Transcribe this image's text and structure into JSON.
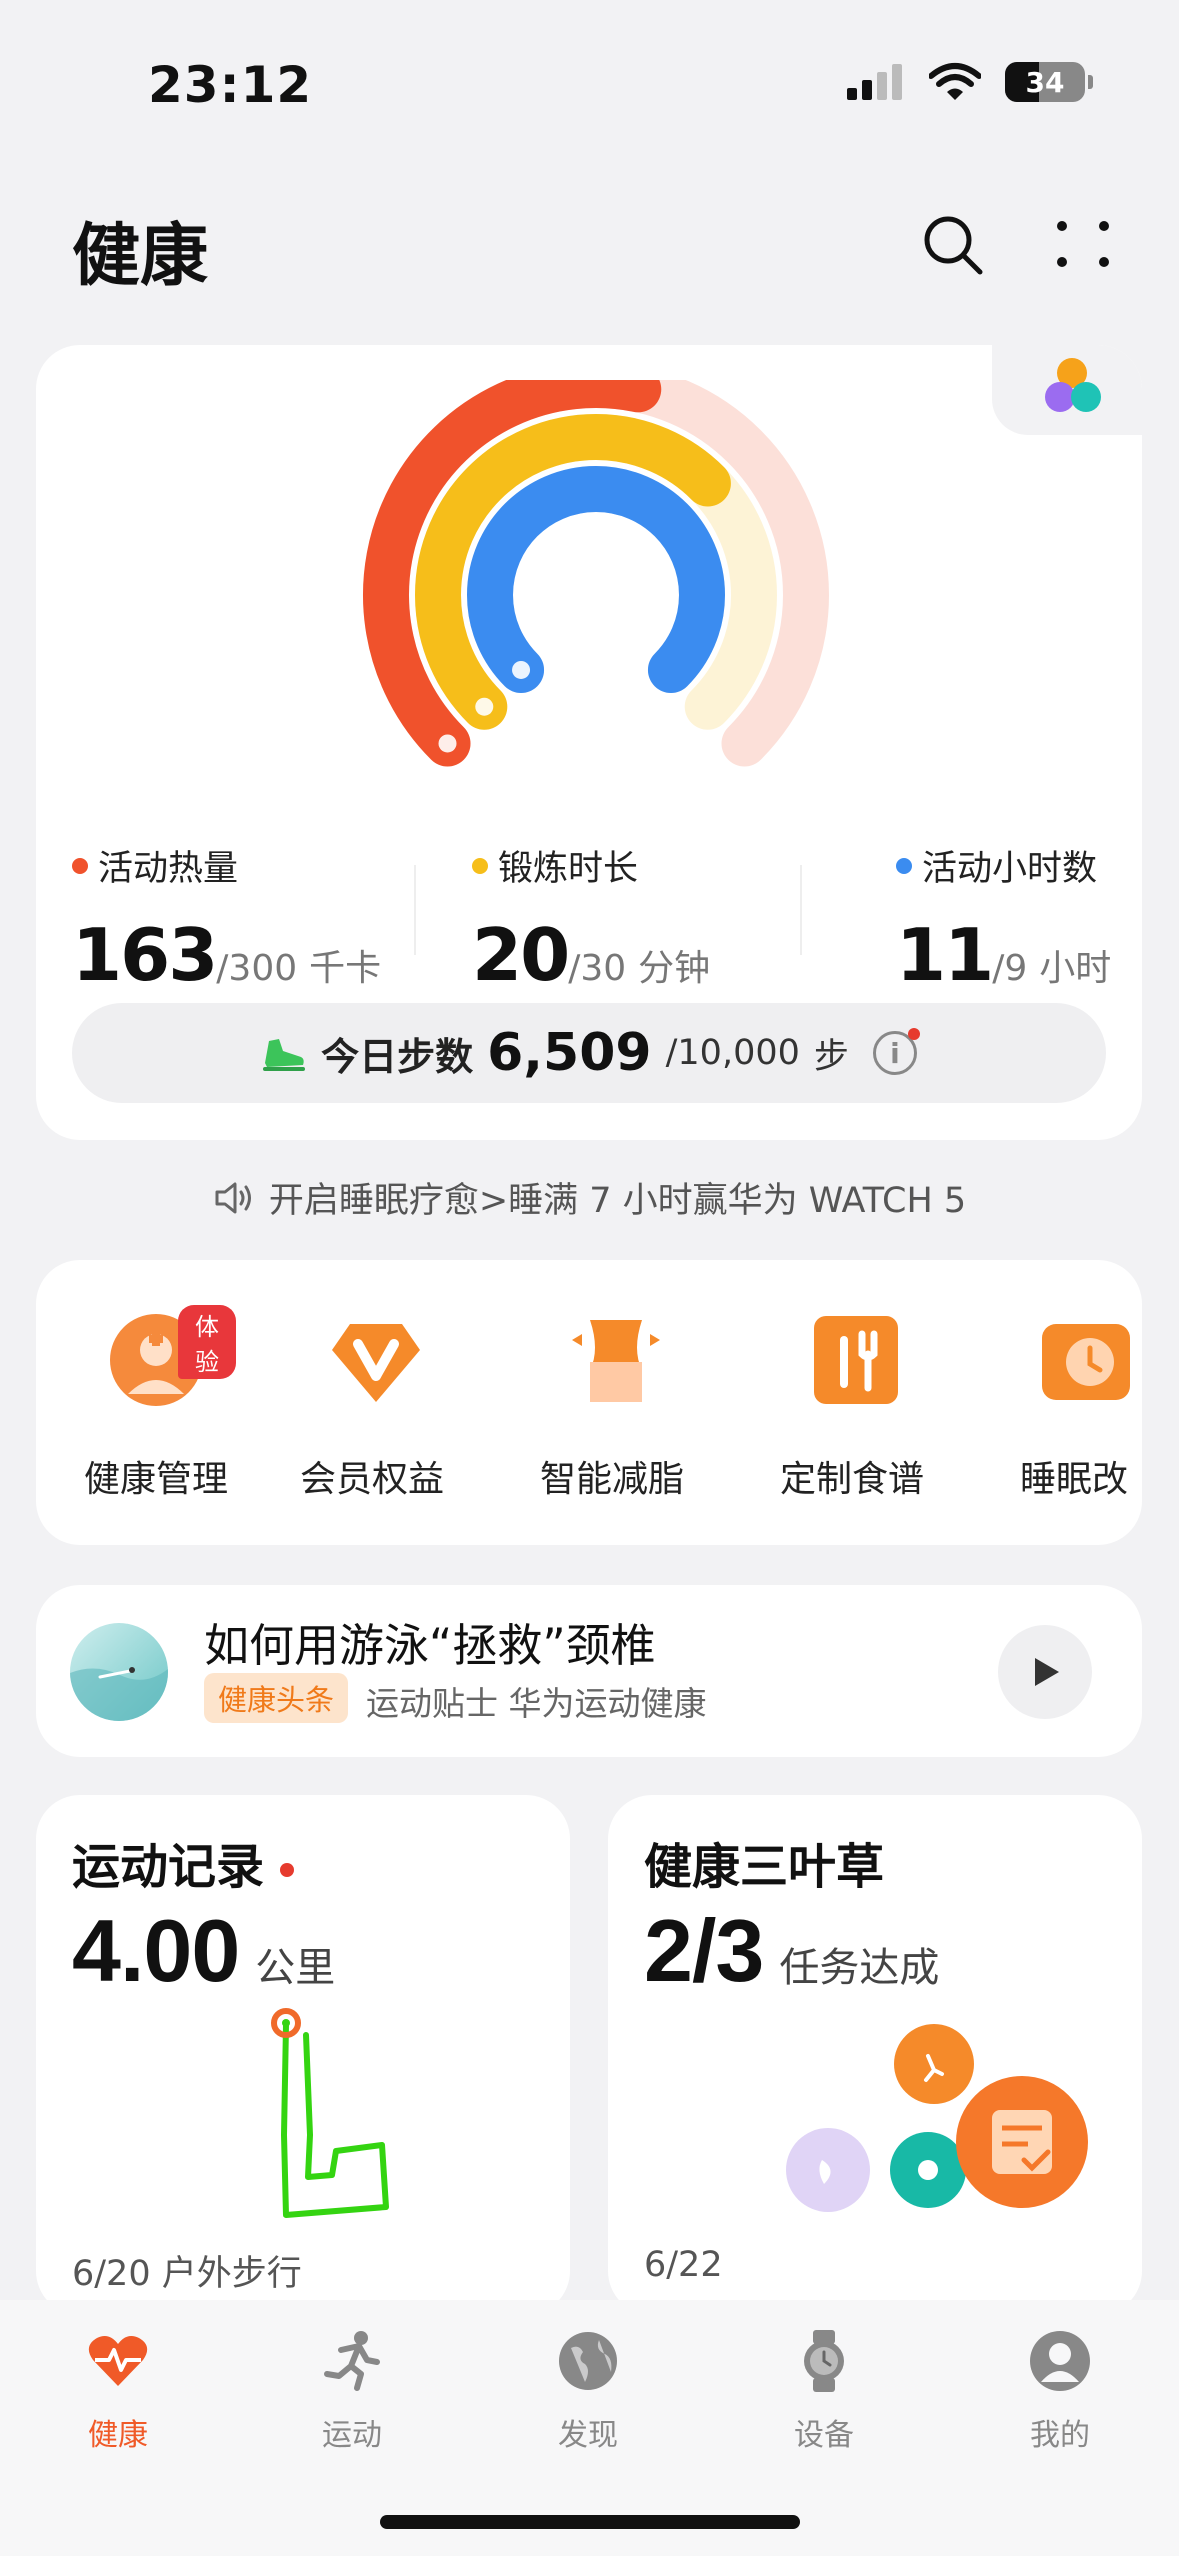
{
  "status_bar": {
    "time": "23:12",
    "battery": "34"
  },
  "header": {
    "title": "健康"
  },
  "activity": {
    "metrics": [
      {
        "label": "活动热量",
        "value": "163",
        "target": "/300",
        "unit": "千卡",
        "color": "#f0522c"
      },
      {
        "label": "锻炼时长",
        "value": "20",
        "target": "/30",
        "unit": "分钟",
        "color": "#f6be1a"
      },
      {
        "label": "活动小时数",
        "value": "11",
        "target": "/9",
        "unit": "小时",
        "color": "#3b8cf0"
      }
    ],
    "rings": [
      {
        "name": "活动热量",
        "progress": 0.543,
        "color": "#f0522c"
      },
      {
        "name": "锻炼时长",
        "progress": 0.667,
        "color": "#f6be1a"
      },
      {
        "name": "活动小时数",
        "progress": 1.0,
        "color": "#3b8cf0"
      }
    ],
    "steps": {
      "label": "今日步数",
      "value": "6,509",
      "target": "/10,000",
      "unit": "步"
    }
  },
  "notice": {
    "text": "开启睡眠疗愈>睡满 7 小时赢华为 WATCH 5"
  },
  "shortcuts": [
    {
      "label": "健康管理",
      "icon": "doctor-icon",
      "badge": "体验"
    },
    {
      "label": "会员权益",
      "icon": "vip-icon"
    },
    {
      "label": "智能减脂",
      "icon": "waist-icon"
    },
    {
      "label": "定制食谱",
      "icon": "utensils-icon"
    },
    {
      "label": "睡眠改",
      "icon": "sleep-clock-icon"
    }
  ],
  "article": {
    "title": "如何用游泳“拯救”颈椎",
    "tag": "健康头条",
    "meta": "运动贴士 华为运动健康"
  },
  "records": {
    "title": "运动记录",
    "value": "4.00",
    "unit": "公里",
    "footer": "6/20 户外步行"
  },
  "clover": {
    "title": "健康三叶草",
    "value": "2/3",
    "unit": "任务达成",
    "footer": "6/22"
  },
  "tabbar": {
    "tabs": [
      {
        "label": "健康",
        "icon": "heart-pulse-icon",
        "active": true
      },
      {
        "label": "运动",
        "icon": "runner-icon"
      },
      {
        "label": "发现",
        "icon": "globe-icon"
      },
      {
        "label": "设备",
        "icon": "watch-icon"
      },
      {
        "label": "我的",
        "icon": "user-icon"
      }
    ]
  },
  "colors": {
    "accent": "#f05a28",
    "background": "#f2f2f4"
  }
}
